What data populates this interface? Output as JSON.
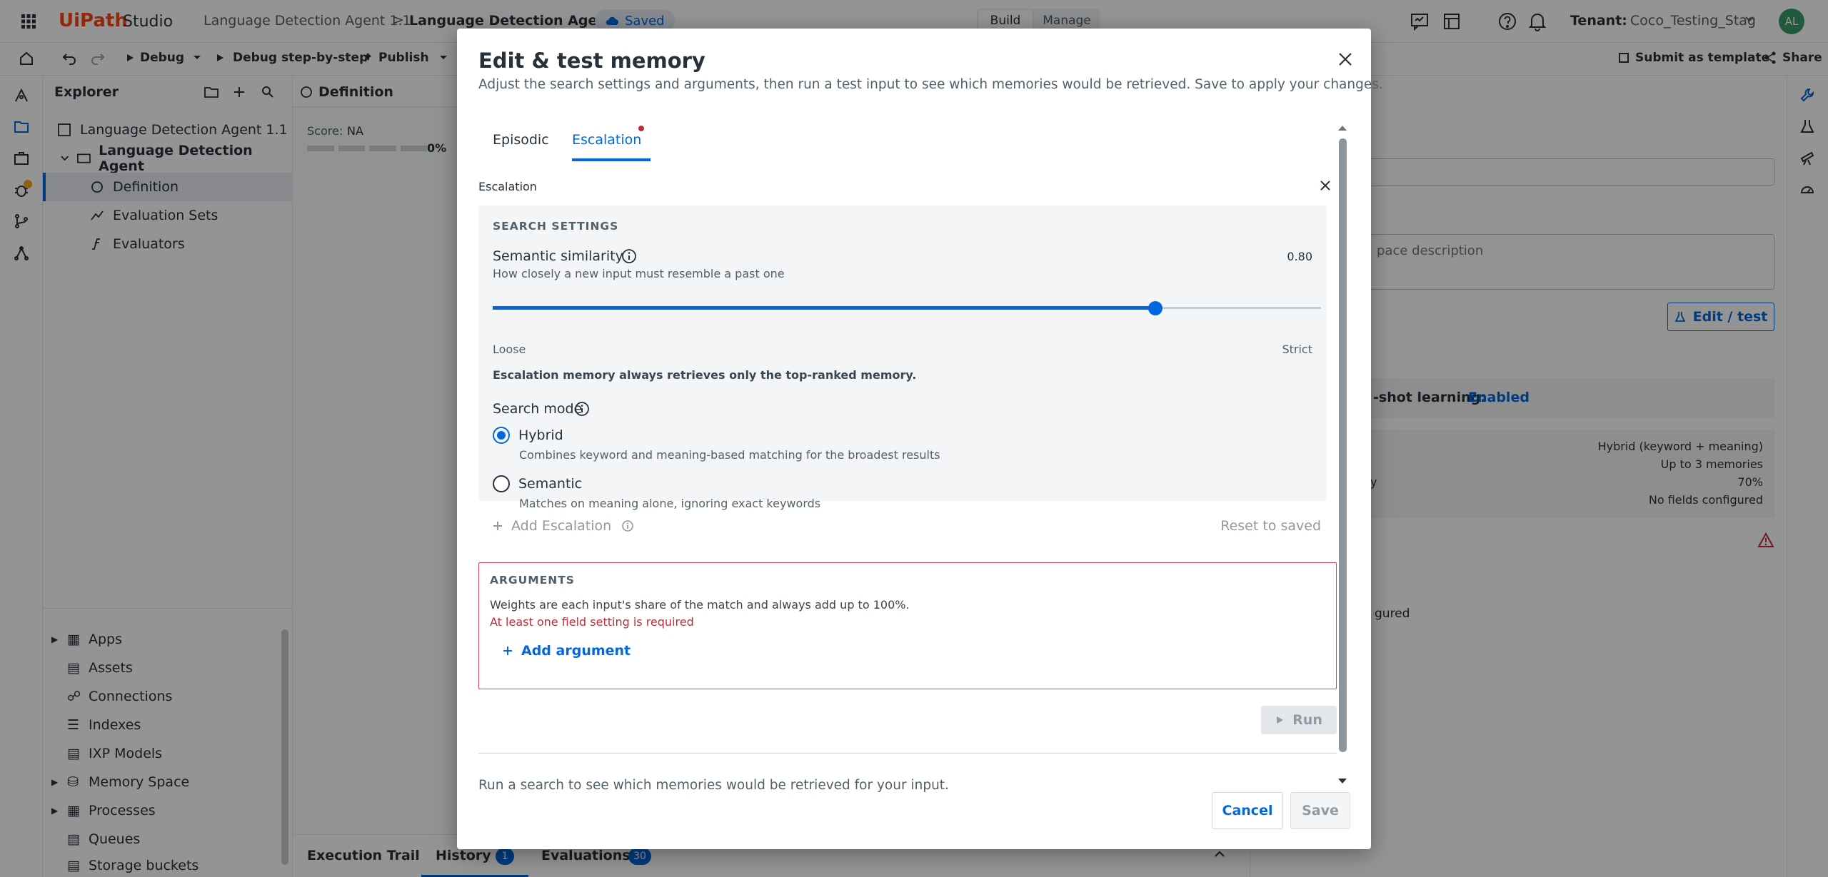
{
  "app": {
    "brand": "UiPath",
    "product": "Studio",
    "tenant_label": "Tenant:",
    "tenant_value": "Coco_Testing_Stag",
    "avatar": "AL"
  },
  "breadcrumb": {
    "parent": "Language Detection Agent 1.1",
    "sep": ">",
    "current": "Language Detection Agent",
    "status": "Saved"
  },
  "mode_tabs": [
    {
      "label": "Build",
      "active": true
    },
    {
      "label": "Manage",
      "active": false
    }
  ],
  "toolbar": {
    "debug": "Debug",
    "debug_step": "Debug step-by-step",
    "publish": "Publish",
    "submit_template": "Submit as template",
    "share": "Share"
  },
  "explorer": {
    "title": "Explorer",
    "project": "Language Detection Agent 1.1",
    "agent": "Language Detection Agent",
    "children": [
      "Definition",
      "Evaluation Sets",
      "Evaluators"
    ],
    "resources": [
      "Apps",
      "Assets",
      "Connections",
      "Indexes",
      "IXP Models",
      "Memory Space",
      "Processes",
      "Queues",
      "Storage buckets"
    ]
  },
  "canvas": {
    "tab_title": "Definition",
    "score_label": "Score:",
    "score_value": "NA",
    "score_pct": "0%",
    "progress_fraction": 0
  },
  "bottom_tabs": [
    {
      "label": "Execution Trail",
      "count": ""
    },
    {
      "label": "History",
      "count": "1"
    },
    {
      "label": "Evaluations",
      "count": "30"
    }
  ],
  "right_pane": {
    "desc_placeholder": "pace description",
    "edit_test_button": "Edit / test",
    "fewshot_text": "-shot learning:",
    "fewshot_value": "Enabled",
    "summary": [
      "Hybrid (keyword + meaning)",
      "Up to 3 memories",
      "70%",
      "No fields configured"
    ],
    "summary_partial": "y",
    "footer_text": "gured"
  },
  "modal": {
    "title": "Edit & test memory",
    "subtitle": "Adjust the search settings and arguments, then run a test input to see which memories would be retrieved. Save to apply your changes.",
    "tabs": [
      {
        "label": "Episodic",
        "active": false
      },
      {
        "label": "Escalation",
        "active": true,
        "dot": true
      }
    ],
    "section_label": "Escalation",
    "search_settings": {
      "heading": "SEARCH SETTINGS",
      "similarity_label": "Semantic similarity",
      "similarity_value": "0.80",
      "similarity_desc": "How closely a new input must resemble a past one",
      "slider_fraction": 0.8,
      "slider_min_label": "Loose",
      "slider_max_label": "Strict",
      "note": "Escalation memory always retrieves only the top-ranked memory.",
      "mode_label": "Search mode",
      "modes": [
        {
          "label": "Hybrid",
          "desc": "Combines keyword and meaning-based matching for the broadest results",
          "selected": true
        },
        {
          "label": "Semantic",
          "desc": "Matches on meaning alone, ignoring exact keywords",
          "selected": false
        }
      ]
    },
    "add_escalation": "Add Escalation",
    "reset": "Reset to saved",
    "arguments": {
      "heading": "ARGUMENTS",
      "desc": "Weights are each input's share of the match and always add up to 100%.",
      "error": "At least one field setting is required",
      "add": "Add argument"
    },
    "run": "Run",
    "result_hint": "Run a search to see which memories would be retrieved for your input.",
    "cancel": "Cancel",
    "save": "Save"
  },
  "colors": {
    "primary": "#0067df",
    "error": "#c02c3a",
    "text": "#273139",
    "muted": "#6b7882",
    "panel": "#f4f5f7"
  }
}
